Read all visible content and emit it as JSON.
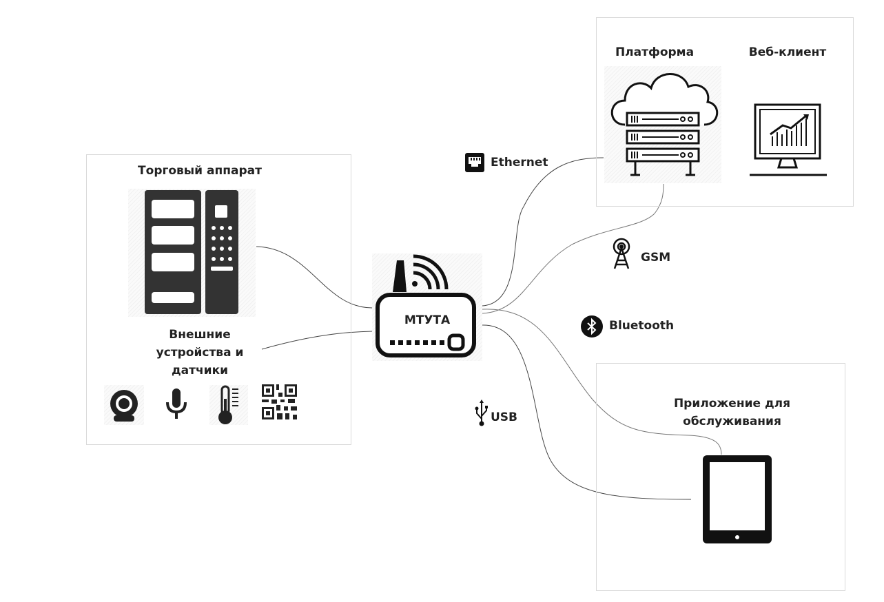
{
  "vending_box": {
    "title": "Торговый аппарат",
    "devices_title": "Внешние устройства и датчики",
    "device_icons": [
      "webcam-icon",
      "microphone-icon",
      "thermometer-icon",
      "qr-code-icon"
    ]
  },
  "router": {
    "label": "МТУТА"
  },
  "connections": {
    "ethernet": "Ethernet",
    "gsm": "GSM",
    "bluetooth": "Bluetooth",
    "usb": "USB"
  },
  "cloud_box": {
    "platform": "Платформа",
    "web_client": "Веб-клиент"
  },
  "service_box": {
    "title": "Приложение для обслуживания"
  },
  "colors": {
    "icon": "#333333",
    "line": "#444444",
    "border": "#d9d9d9"
  }
}
